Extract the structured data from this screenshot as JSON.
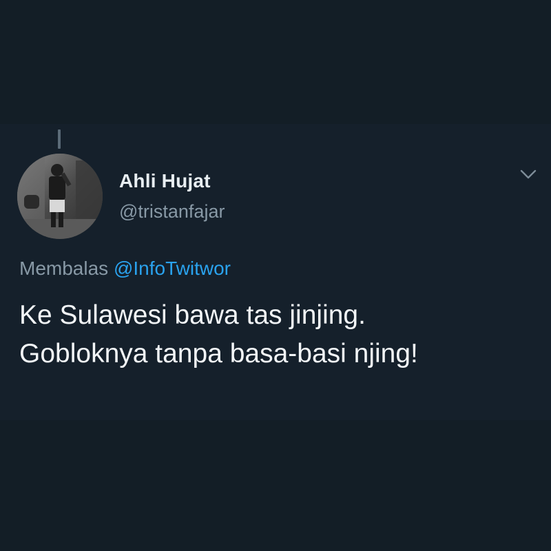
{
  "tweet": {
    "author": {
      "display_name": "Ahli Hujat",
      "handle": "@tristanfajar",
      "avatar_icon": "profile-photo"
    },
    "reply": {
      "prefix": "Membalas ",
      "mention": "@InfoTwitwor"
    },
    "text_lines": [
      "Ke Sulawesi bawa tas jinjing.",
      "Gobloknya tanpa basa-basi njing!"
    ],
    "menu_icon": "chevron-down-icon"
  },
  "colors": {
    "background": "#131e26",
    "name": "#e8eef2",
    "secondary": "#8899a6",
    "mention": "#2aa3ef",
    "text": "#f2f5f7"
  }
}
